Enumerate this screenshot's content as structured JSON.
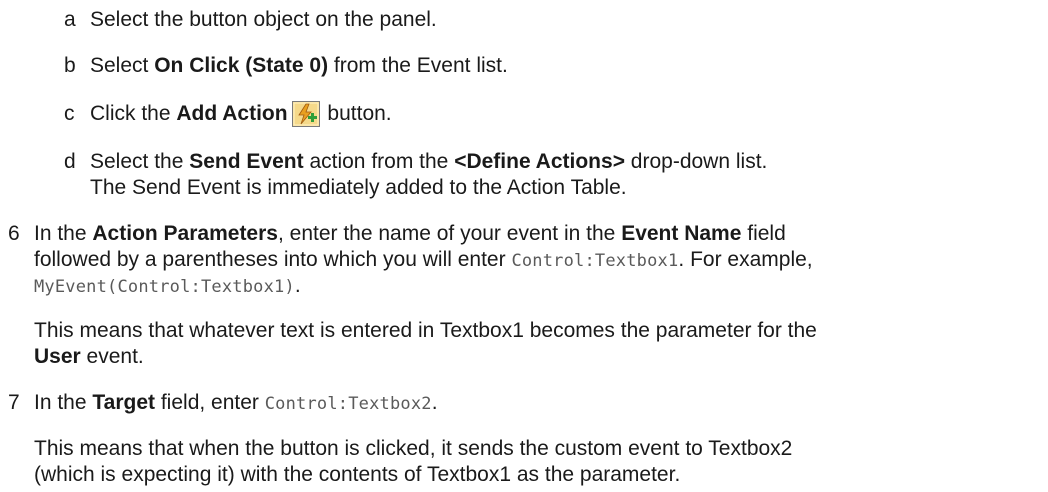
{
  "steps": {
    "a": {
      "marker": "a",
      "text": "Select the button object on the panel."
    },
    "b": {
      "marker": "b",
      "pre": "Select ",
      "bold": "On Click (State 0)",
      "post": " from the Event list."
    },
    "c": {
      "marker": "c",
      "pre": "Click the ",
      "bold": "Add Action",
      "icon": "add-action-icon",
      "post": " button."
    },
    "d": {
      "marker": "d",
      "pre": "Select the ",
      "bold1": "Send Event",
      "mid": " action from the ",
      "bold2": "<Define Actions>",
      "post": " drop-down list.",
      "line2": "The Send Event is immediately added to the Action Table."
    },
    "s6": {
      "marker": "6",
      "l1_pre": "In the ",
      "l1_bold1": "Action Parameters",
      "l1_mid": ", enter the name of your event in the ",
      "l1_bold2": "Event Name",
      "l1_post": " field",
      "l2_pre": "followed by a parentheses into which you will enter ",
      "l2_code": "Control:Textbox1",
      "l2_post": ". For example,",
      "l3_code": "MyEvent(Control:Textbox1)",
      "l3_post": ".",
      "p2_l1": "This means that whatever text is entered in Textbox1 becomes the parameter for the",
      "p2_l2_bold": "User",
      "p2_l2_post": " event."
    },
    "s7": {
      "marker": "7",
      "l1_pre": "In the ",
      "l1_bold": "Target",
      "l1_mid": " field, enter ",
      "l1_code": "Control:Textbox2",
      "l1_post": ".",
      "p2_l1": "This means that when the button is clicked, it sends the custom event to Textbox2",
      "p2_l2": "(which is expecting it) with the contents of Textbox1 as the parameter."
    }
  },
  "colors": {
    "text": "#1a1a1a",
    "code": "#5a5a5a",
    "icon_bg": "#f5d98a",
    "icon_bolt": "#e8a020",
    "icon_plus": "#2e9e3a"
  }
}
